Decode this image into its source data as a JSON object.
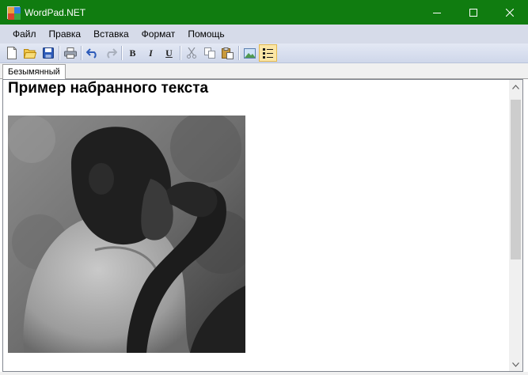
{
  "window": {
    "title": "WordPad.NET",
    "accent": "#107c10"
  },
  "menu": {
    "file": "Файл",
    "edit": "Правка",
    "insert": "Вставка",
    "format": "Формат",
    "help": "Помощь"
  },
  "toolbar": {
    "bold": "B",
    "italic": "I",
    "underline": "U"
  },
  "tab": {
    "label": "Безымянный"
  },
  "document": {
    "heading": "Пример набранного текста",
    "image_subject": "chimpanzee-photo"
  }
}
